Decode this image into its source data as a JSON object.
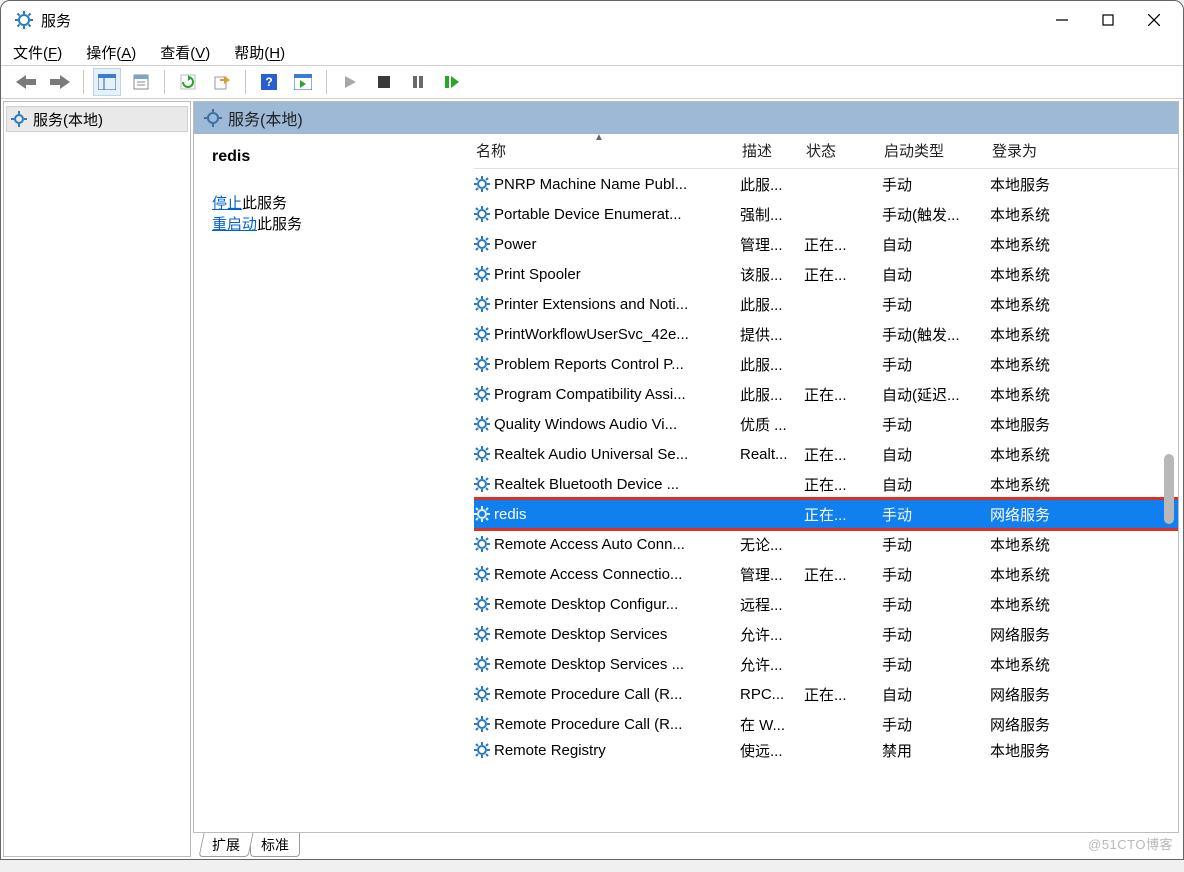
{
  "window": {
    "title": "服务"
  },
  "menus": {
    "file": "文件",
    "file_u": "F",
    "action": "操作",
    "action_u": "A",
    "view": "查看",
    "view_u": "V",
    "help": "帮助",
    "help_u": "H"
  },
  "sidebar": {
    "item": "服务(本地)"
  },
  "pane": {
    "header": "服务(本地)"
  },
  "detail": {
    "selected_name": "redis",
    "stop_link": "停止",
    "stop_suffix": "此服务",
    "restart_link": "重启动",
    "restart_suffix": "此服务"
  },
  "columns": {
    "name": "名称",
    "desc": "描述",
    "status": "状态",
    "startup": "启动类型",
    "logon": "登录为"
  },
  "services": [
    {
      "name": "PNRP Machine Name Publ...",
      "desc": "此服...",
      "status": "",
      "startup": "手动",
      "logon": "本地服务"
    },
    {
      "name": "Portable Device Enumerat...",
      "desc": "强制...",
      "status": "",
      "startup": "手动(触发...",
      "logon": "本地系统"
    },
    {
      "name": "Power",
      "desc": "管理...",
      "status": "正在...",
      "startup": "自动",
      "logon": "本地系统"
    },
    {
      "name": "Print Spooler",
      "desc": "该服...",
      "status": "正在...",
      "startup": "自动",
      "logon": "本地系统"
    },
    {
      "name": "Printer Extensions and Noti...",
      "desc": "此服...",
      "status": "",
      "startup": "手动",
      "logon": "本地系统"
    },
    {
      "name": "PrintWorkflowUserSvc_42e...",
      "desc": "提供...",
      "status": "",
      "startup": "手动(触发...",
      "logon": "本地系统"
    },
    {
      "name": "Problem Reports Control P...",
      "desc": "此服...",
      "status": "",
      "startup": "手动",
      "logon": "本地系统"
    },
    {
      "name": "Program Compatibility Assi...",
      "desc": "此服...",
      "status": "正在...",
      "startup": "自动(延迟...",
      "logon": "本地系统"
    },
    {
      "name": "Quality Windows Audio Vi...",
      "desc": "优质 ...",
      "status": "",
      "startup": "手动",
      "logon": "本地服务"
    },
    {
      "name": "Realtek Audio Universal Se...",
      "desc": "Realt...",
      "status": "正在...",
      "startup": "自动",
      "logon": "本地系统"
    },
    {
      "name": "Realtek Bluetooth Device ...",
      "desc": "",
      "status": "正在...",
      "startup": "自动",
      "logon": "本地系统"
    },
    {
      "name": "redis",
      "desc": "",
      "status": "正在...",
      "startup": "手动",
      "logon": "网络服务",
      "selected": true,
      "highlight": true
    },
    {
      "name": "Remote Access Auto Conn...",
      "desc": "无论...",
      "status": "",
      "startup": "手动",
      "logon": "本地系统"
    },
    {
      "name": "Remote Access Connectio...",
      "desc": "管理...",
      "status": "正在...",
      "startup": "手动",
      "logon": "本地系统"
    },
    {
      "name": "Remote Desktop Configur...",
      "desc": "远程...",
      "status": "",
      "startup": "手动",
      "logon": "本地系统"
    },
    {
      "name": "Remote Desktop Services",
      "desc": "允许...",
      "status": "",
      "startup": "手动",
      "logon": "网络服务"
    },
    {
      "name": "Remote Desktop Services ...",
      "desc": "允许...",
      "status": "",
      "startup": "手动",
      "logon": "本地系统"
    },
    {
      "name": "Remote Procedure Call (R...",
      "desc": "RPC...",
      "status": "正在...",
      "startup": "自动",
      "logon": "网络服务"
    },
    {
      "name": "Remote Procedure Call (R...",
      "desc": "在 W...",
      "status": "",
      "startup": "手动",
      "logon": "网络服务"
    },
    {
      "name": "Remote Registry",
      "desc": "使远...",
      "status": "",
      "startup": "禁用",
      "logon": "本地服务",
      "clipped": true
    }
  ],
  "tabs": {
    "extended": "扩展",
    "standard": "标准"
  },
  "watermark": "@51CTO博客"
}
